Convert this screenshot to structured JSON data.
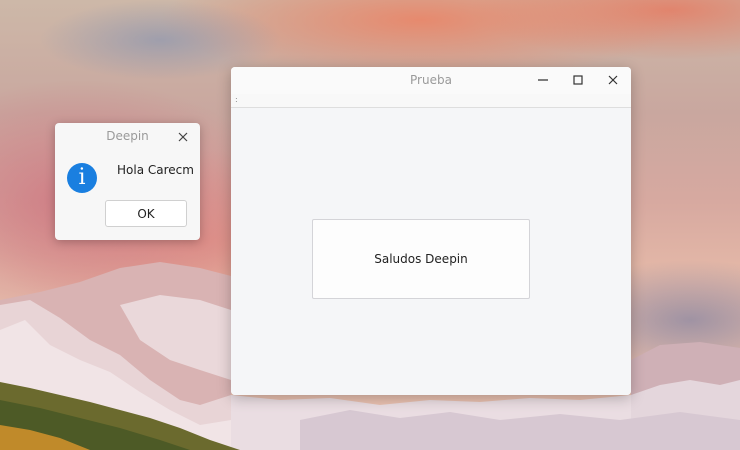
{
  "desktop": {
    "wallpaper": "mountain-sunset"
  },
  "message_box": {
    "title": "Deepin",
    "message": "Hola Carecm",
    "ok_label": "OK",
    "icon": "info-icon",
    "icon_glyph": "i",
    "accent_color": "#1a7fe0"
  },
  "main_window": {
    "title": "Prueba",
    "menubar_grip": ":",
    "button_label": "Saludos Deepin",
    "controls": [
      "minimize-icon",
      "maximize-icon",
      "close-icon"
    ]
  }
}
